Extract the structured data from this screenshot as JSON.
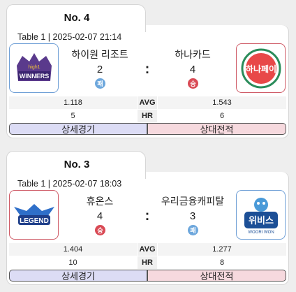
{
  "games": [
    {
      "number": "No. 4",
      "meta": "Table 1 | 2025-02-07 21:14",
      "home": {
        "name": "하이원 리조트",
        "score": "2",
        "result": "패",
        "logo_text": "WINNERS",
        "logo_small": "high1",
        "color": "#6f9fd6"
      },
      "away": {
        "name": "하나카드",
        "score": "4",
        "result": "승",
        "logo_text": "하나페이",
        "color": "#cf5a66"
      },
      "separator": ":",
      "stats": [
        {
          "home": "1.118",
          "label": "AVG",
          "away": "1.543"
        },
        {
          "home": "5",
          "label": "HR",
          "away": "6"
        }
      ],
      "buttons": {
        "detail": "상세경기",
        "h2h": "상대전적"
      }
    },
    {
      "number": "No. 3",
      "meta": "Table 1 | 2025-02-07 18:03",
      "home": {
        "name": "휴온스",
        "score": "4",
        "result": "승",
        "logo_text": "LEGEND",
        "color": "#cf5a66"
      },
      "away": {
        "name": "우리금융캐피탈",
        "score": "3",
        "result": "패",
        "logo_text": "위비스",
        "logo_small": "WOORI WON",
        "color": "#6f9fd6"
      },
      "separator": ":",
      "stats": [
        {
          "home": "1.404",
          "label": "AVG",
          "away": "1.277"
        },
        {
          "home": "10",
          "label": "HR",
          "away": "8"
        }
      ],
      "buttons": {
        "detail": "상세경기",
        "h2h": "상대전적"
      }
    }
  ]
}
